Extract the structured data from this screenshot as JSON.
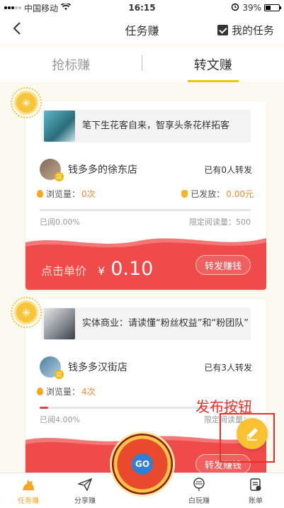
{
  "status_bar": {
    "carrier": "中国移动",
    "time": "16:15",
    "battery": "39%",
    "battery_level": 0.39
  },
  "nav": {
    "title": "任务赚",
    "my_tasks": "我的任务"
  },
  "tabs": [
    {
      "label": "抢标赚",
      "active": false
    },
    {
      "label": "转文赚",
      "active": true
    }
  ],
  "cards": [
    {
      "title": "笔下生花客自来，智享头条花样拓客",
      "shop_name": "钱多多的徐东店",
      "shop_tag": "店",
      "shares": "已有0人转发",
      "views_label": "浏览量：",
      "views_value": "0次",
      "paid_label": "已发放：",
      "paid_value": "0.00元",
      "progress": 0.0,
      "read_pct": "已阅0.00%",
      "read_limit": "限定阅读量：500",
      "price_label": "点击单价",
      "price_currency": "¥",
      "price_value": "0.10",
      "share_button": "转发赚钱"
    },
    {
      "title": "实体商业：请读懂“粉丝权益”和“粉团队”",
      "shop_name": "钱多多汉街店",
      "shop_tag": "店",
      "shares": "已有3人转发",
      "views_label": "浏览量：",
      "views_value": "4次",
      "read_pct": "已阅4.00%",
      "read_limit": "限定阅读量：",
      "progress": 0.04,
      "share_button": "转发赚钱"
    }
  ],
  "annotation": {
    "label": "发布按钮"
  },
  "bottom_nav": [
    {
      "label": "任务赚",
      "icon": "dog-icon",
      "active": true
    },
    {
      "label": "分享赚",
      "icon": "paper-plane-icon",
      "active": false
    },
    {
      "label": "白玩赚",
      "icon": "balloon-icon",
      "active": false
    },
    {
      "label": "账单",
      "icon": "bill-icon",
      "active": false
    }
  ],
  "wheel": {
    "label": "GO"
  },
  "colors": {
    "accent": "#f5c400",
    "price_red": "#f04b4b",
    "orange": "#f08a3a",
    "annotation_red": "#e8302a"
  }
}
